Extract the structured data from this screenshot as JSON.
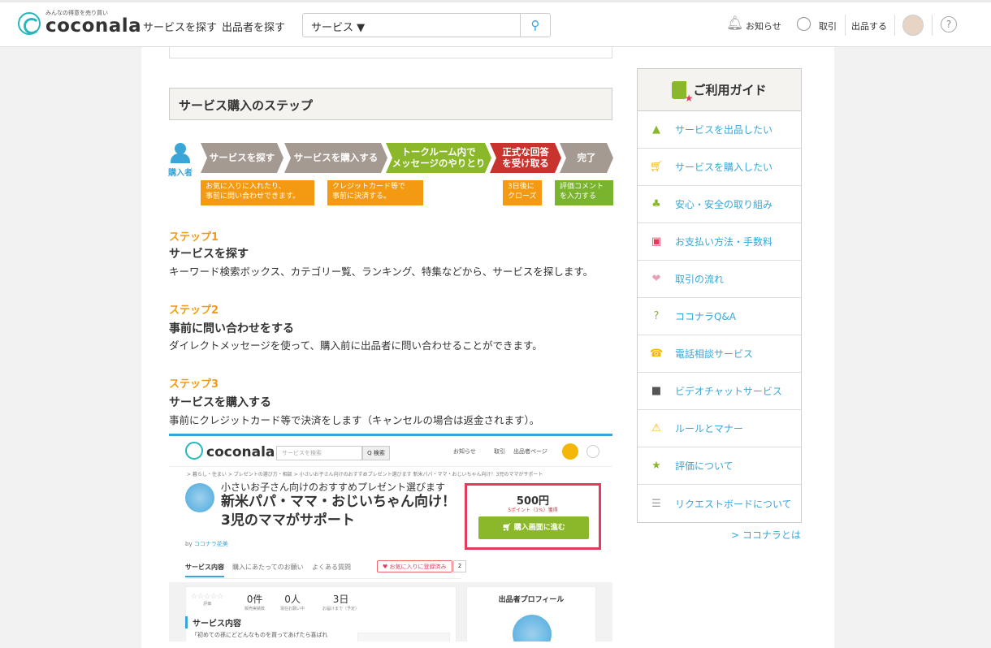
{
  "header": {
    "logo_tagline": "みんなの得意を売り買い",
    "logo_text": "coconala",
    "nav": [
      "サービスを探す",
      "出品者を探す"
    ],
    "search_select": "サービス ▼",
    "search_placeholder": "",
    "notifications": "お知らせ",
    "trades": "取引",
    "sell": "出品する"
  },
  "section_title": "サービス購入のステップ",
  "flow": {
    "buyer_label": "購入者",
    "arrows": [
      "サービスを探す",
      "サービスを購入する",
      "トークルーム内で\nメッセージのやりとり",
      "正式な回答\nを受け取る",
      "完了"
    ],
    "notes": [
      "お気に入りに入れたり、\n事前に問い合わせできます。",
      "クレジットカード等で\n事前に決済する。",
      "3日後に\nクローズ",
      "評価コメント\nを入力する"
    ]
  },
  "steps": [
    {
      "label": "ステップ1",
      "heading": "サービスを探す",
      "desc": "キーワード検索ボックス、カテゴリー覧、ランキング、特集などから、サービスを探します。"
    },
    {
      "label": "ステップ2",
      "heading": "事前に問い合わせをする",
      "desc": "ダイレクトメッセージを使って、購入前に出品者に問い合わせることができます。"
    },
    {
      "label": "ステップ3",
      "heading": "サービスを購入する",
      "desc": "事前にクレジットカード等で決済をします（キャンセルの場合は返金されます）。"
    }
  ],
  "screenshot": {
    "logo_text": "coconala",
    "search_placeholder": "サービスを検索",
    "search_btn": "Q 検索",
    "notif": "お知らせ",
    "trades": "取引",
    "seller_page": "出品者ページ",
    "breadcrumb": "> 暮らし・住まい > プレゼントの選び方・相談 > 小さいお子さん向けのおすすめプレゼント選びます 新米パパ・ママ・おじいちゃん向け！3児のママがサポート",
    "subtitle": "小さいお子さん向けのおすすめプレゼント選びます",
    "title": "新米パパ・ママ・おじいちゃん向け！3児のママがサポート",
    "by_prefix": "by ",
    "by_name": "ココナラ花美",
    "price": "500円",
    "points": "5ポイント（1%）獲得",
    "buy_btn": "購入画面に進む",
    "tabs": [
      "サービス内容",
      "購入にあたってのお願い",
      "よくある質問"
    ],
    "fav": "♥ お気に入りに登録済み",
    "fav_count": "2",
    "stats": [
      {
        "value": "☆☆☆☆☆",
        "label": "評価"
      },
      {
        "value": "0件",
        "label": "販売実績数"
      },
      {
        "value": "0人",
        "label": "現在お願い中"
      },
      {
        "value": "3日",
        "label": "お届けまで（予定）"
      }
    ],
    "service_heading": "サービス内容",
    "service_desc": "「初めての孫にどどんなものを買ってあげたら喜ばれ",
    "profile_heading": "出品者プロフィール"
  },
  "guide": {
    "title": "ご利用ガイド",
    "items": [
      {
        "label": "サービスを出品したい",
        "icon": "seller-icon",
        "color": "#8bb82b"
      },
      {
        "label": "サービスを購入したい",
        "icon": "cart-icon",
        "color": "#f3b60a"
      },
      {
        "label": "安心・安全の取り組み",
        "icon": "clover-icon",
        "color": "#8bb82b"
      },
      {
        "label": "お支払い方法・手数料",
        "icon": "card-icon",
        "color": "#e33b5e"
      },
      {
        "label": "取引の流れ",
        "icon": "handshake-icon",
        "color": "#e8a0b8"
      },
      {
        "label": "ココナラQ&A",
        "icon": "question-person-icon",
        "color": "#8bb82b"
      },
      {
        "label": "電話相談サービス",
        "icon": "phone-icon",
        "color": "#f3b60a"
      },
      {
        "label": "ビデオチャットサービス",
        "icon": "video-icon",
        "color": "#555555"
      },
      {
        "label": "ルールとマナー",
        "icon": "warning-icon",
        "color": "#f3b60a"
      },
      {
        "label": "評価について",
        "icon": "rating-icon",
        "color": "#8bb82b"
      },
      {
        "label": "リクエストボードについて",
        "icon": "board-icon",
        "color": "#999999"
      }
    ],
    "about": "> ココナラとは"
  }
}
